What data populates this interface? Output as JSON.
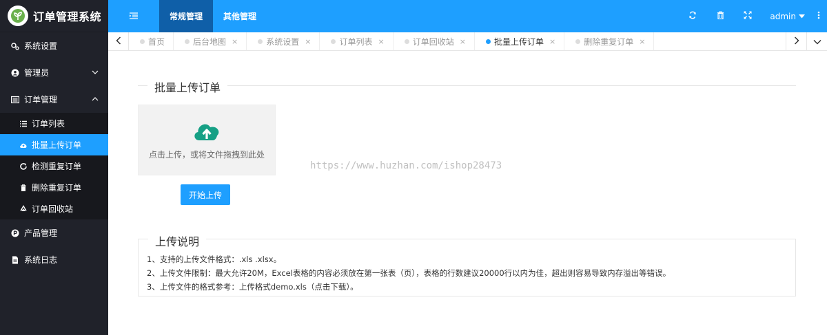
{
  "app": {
    "title": "订单管理系统"
  },
  "sidebar": {
    "items": [
      {
        "label": "系统设置",
        "icon": "gears-icon"
      },
      {
        "label": "管理员",
        "icon": "user-circle-icon"
      },
      {
        "label": "订单管理",
        "icon": "list-box-icon"
      },
      {
        "label": "产品管理",
        "icon": "p-circle-icon"
      },
      {
        "label": "系统日志",
        "icon": "file-icon"
      }
    ],
    "subitems": [
      {
        "label": "订单列表",
        "icon": "list-icon"
      },
      {
        "label": "批量上传订单",
        "icon": "cloud-upload-icon"
      },
      {
        "label": "检测重复订单",
        "icon": "refresh-icon"
      },
      {
        "label": "删除重复订单",
        "icon": "trash-icon"
      },
      {
        "label": "订单回收站",
        "icon": "recycle-icon"
      }
    ]
  },
  "topbar": {
    "tabs": [
      {
        "label": "常规管理"
      },
      {
        "label": "其他管理"
      }
    ],
    "user": "admin"
  },
  "tabstrip": {
    "tabs": [
      {
        "label": "首页"
      },
      {
        "label": "后台地图"
      },
      {
        "label": "系统设置"
      },
      {
        "label": "订单列表"
      },
      {
        "label": "订单回收站"
      },
      {
        "label": "批量上传订单"
      },
      {
        "label": "删除重复订单"
      }
    ],
    "close_glyph": "×"
  },
  "main": {
    "upload_legend": "批量上传订单",
    "upload_hint": "点击上传，或将文件拖拽到此处",
    "upload_button": "开始上传",
    "watermark": "https://www.huzhan.com/ishop28473",
    "info_legend": "上传说明",
    "info_lines": [
      "1、支持的上传文件格式：.xls .xlsx。",
      "2、上传文件限制：最大允许20M，Excel表格的内容必须放在第一张表（页），表格的行数建议20000行以内为佳，超出则容易导致内存溢出等错误。",
      "3、上传文件的格式参考：上传格式demo.xls（点击下载）。"
    ]
  },
  "colors": {
    "accent": "#1e9fff",
    "sidebar_bg": "#20222a",
    "active_top": "#0f5fa8",
    "upload_icon": "#16a085"
  }
}
